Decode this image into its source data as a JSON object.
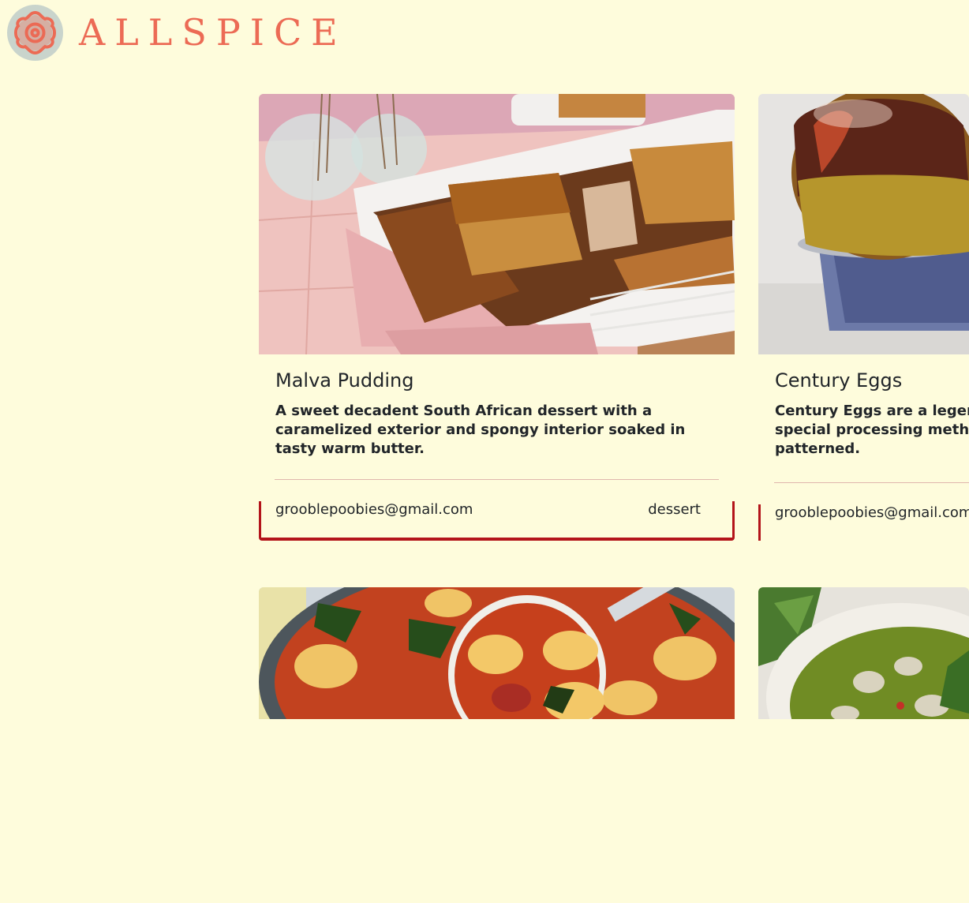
{
  "header": {
    "brand": "ALLSPICE",
    "logo_icon": "flower-icon"
  },
  "colors": {
    "background": "#fefcdc",
    "brand": "#ec6b55",
    "accent_border": "#b3141a",
    "divider": "#e0b7ad"
  },
  "recipes": [
    {
      "title": "Malva Pudding",
      "description": "A sweet decadent South African dessert with a caramelized exterior and spongy interior soaked in tasty warm butter.",
      "creator": "grooblepoobies@gmail.com",
      "category": "dessert"
    },
    {
      "title": "Century Eggs",
      "description": "Century Eggs are a legenda special processing method, patterned.",
      "creator": "grooblepoobies@gmail.com",
      "category": ""
    },
    {
      "title": "",
      "description": "",
      "creator": "",
      "category": ""
    },
    {
      "title": "",
      "description": "",
      "creator": "",
      "category": ""
    }
  ]
}
